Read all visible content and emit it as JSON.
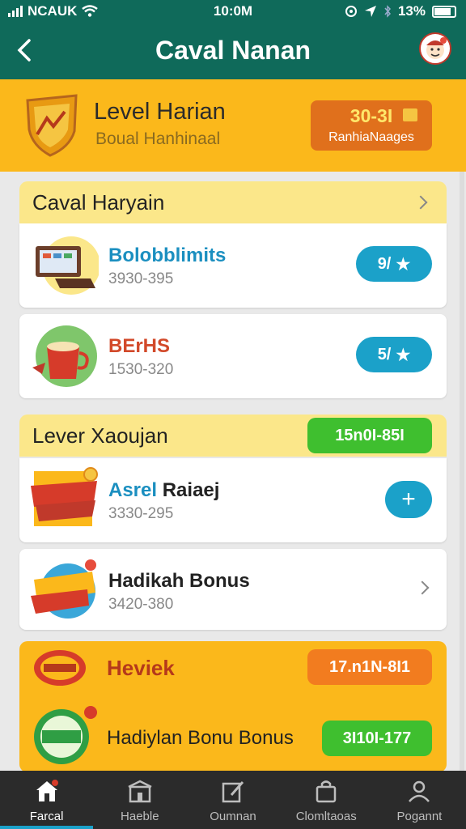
{
  "status": {
    "carrier": "NCAUK",
    "time": "10:0M",
    "battery": "13%"
  },
  "appbar": {
    "title": "Caval Nanan"
  },
  "hero": {
    "title": "Level Harian",
    "subtitle": "Boual Hanhinaal",
    "badge_value": "30-3I",
    "badge_label": "RanhiaNaages"
  },
  "section1": {
    "title": "Caval Haryain",
    "items": [
      {
        "name": "Bolobblimits",
        "range": "3930-395",
        "badge": "9/",
        "name_color": "#1b8fc0",
        "icon": "laptop-icon"
      },
      {
        "name": "BErHS",
        "range": "1530-320",
        "badge": "5/",
        "name_color": "#d2492a",
        "icon": "cup-icon"
      }
    ]
  },
  "section2": {
    "title": "Lever Xaoujan",
    "badge": "15n0I-85I",
    "items": [
      {
        "name": "Asrel",
        "name2": "Raiaej",
        "range": "3330-295",
        "icon": "ribbon-icon"
      },
      {
        "name": "Hadikah Bonus",
        "range": "3420-380",
        "icon": "sale-icon"
      }
    ]
  },
  "section3": {
    "title": "Heviek",
    "badge": "17.n1N-8I1",
    "item": {
      "name": "Hadiylan Bonu Bonus",
      "badge": "3I10I-177"
    }
  },
  "tabs": [
    {
      "label": "Farcal",
      "icon": "home-icon"
    },
    {
      "label": "Haeble",
      "icon": "store-icon"
    },
    {
      "label": "Oumnan",
      "icon": "edit-icon"
    },
    {
      "label": "Clomltaoas",
      "icon": "bag-icon"
    },
    {
      "label": "Pogannt",
      "icon": "person-icon"
    }
  ],
  "colors": {
    "header": "#0f6a5a",
    "accent_yellow": "#fbb81b",
    "accent_blue": "#1ba1c9",
    "accent_green": "#3fbf2f",
    "accent_orange": "#f27c1f"
  }
}
